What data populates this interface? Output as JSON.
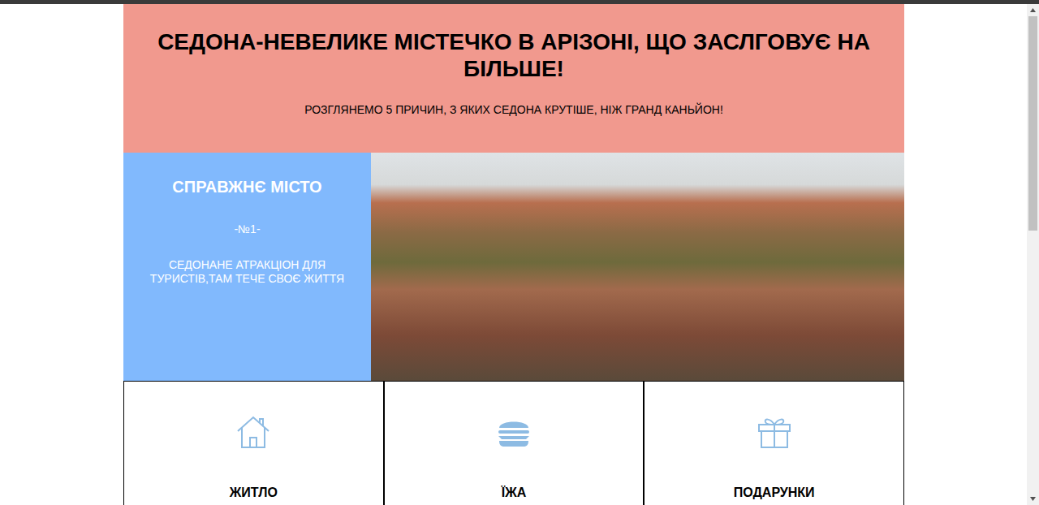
{
  "header": {
    "title": "СЕДОНА-НЕВЕЛИКЕ МІСТЕЧКО В АРІЗОНІ, ЩО ЗАСЛГОВУЄ НА БІЛЬШЕ!",
    "subtitle": "РОЗГЛЯНЕМО 5 ПРИЧИН, З ЯКИХ СЕДОНА КРУТІШЕ, НІЖ ГРАНД КАНЬЙОН!"
  },
  "feature": {
    "heading": "СПРАВЖНЄ МІСТО",
    "number": "-№1-",
    "text": "СЕДОНАНЕ АТРАКЦІОН ДЛЯ ТУРИСТІВ,ТАМ ТЕЧЕ СВОЄ ЖИТТЯ"
  },
  "cards": [
    {
      "label": "ЖИТЛО",
      "kind": "house"
    },
    {
      "label": "ЇЖА",
      "kind": "burger"
    },
    {
      "label": "ПОДАРУНКИ",
      "kind": "gift"
    }
  ],
  "scrollbar": {
    "level": 0.45
  }
}
